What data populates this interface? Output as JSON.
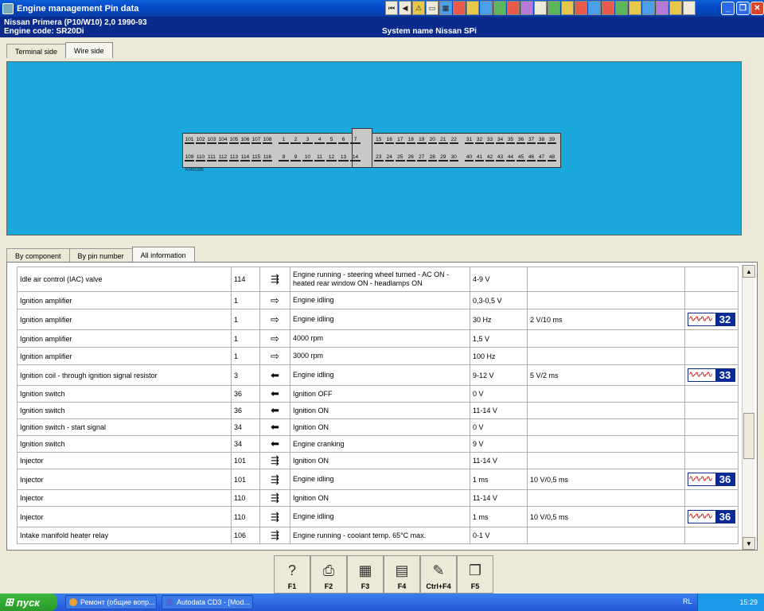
{
  "window": {
    "title": "Engine management Pin data"
  },
  "toolbar_icons": [
    "first-icon",
    "prev-icon",
    "warning-icon",
    "doc-icon",
    "chart-icon",
    "tool1-icon",
    "tool2-icon",
    "tool3-icon",
    "tool4-icon",
    "tool5-icon",
    "tool6-icon",
    "tool7-icon",
    "tool8-icon",
    "tool9-icon",
    "tool10-icon",
    "tool11-icon",
    "tool12-icon",
    "tool13-icon",
    "tool14-icon",
    "tool15-icon",
    "tool16-icon",
    "tool17-icon",
    "tool18-icon"
  ],
  "vehicle": {
    "line1": "Nissan  Primera (P10/W10) 2,0  1990-93",
    "line2": "Engine code: SR20Di",
    "system": "System name Nissan SPi"
  },
  "top_tabs": [
    "Terminal side",
    "Wire side"
  ],
  "connector": {
    "left_top": [
      "101",
      "102",
      "103",
      "104",
      "105",
      "106",
      "107",
      "108"
    ],
    "left_bottom": [
      "109",
      "110",
      "111",
      "112",
      "113",
      "114",
      "115",
      "116"
    ],
    "mid_top": [
      "1",
      "2",
      "3",
      "4",
      "5",
      "6",
      "7"
    ],
    "mid_bottom": [
      "8",
      "9",
      "10",
      "11",
      "12",
      "13",
      "14"
    ],
    "r1_top": [
      "15",
      "16",
      "17",
      "18",
      "19",
      "20",
      "21",
      "22"
    ],
    "r1_bottom": [
      "23",
      "24",
      "25",
      "26",
      "27",
      "28",
      "29",
      "30"
    ],
    "r2_top": [
      "31",
      "32",
      "33",
      "34",
      "35",
      "36",
      "37",
      "38",
      "39"
    ],
    "r2_bottom": [
      "40",
      "41",
      "42",
      "43",
      "44",
      "45",
      "46",
      "47",
      "48"
    ],
    "code": "K0431395"
  },
  "bottom_tabs": [
    "By component",
    "By pin number",
    "All information"
  ],
  "rows": [
    {
      "component": "Idle air control (IAC) valve",
      "pin": "114",
      "dir": "⇶",
      "condition": "Engine running - steering wheel turned - AC ON - heated rear window ON - headlamps ON",
      "value": "4-9 V",
      "setting": "",
      "wave": ""
    },
    {
      "component": "Ignition amplifier",
      "pin": "1",
      "dir": "⇨",
      "condition": "Engine idling",
      "value": "0,3-0,5 V",
      "setting": "",
      "wave": ""
    },
    {
      "component": "Ignition amplifier",
      "pin": "1",
      "dir": "⇨",
      "condition": "Engine idling",
      "value": "30 Hz",
      "setting": "2 V/10 ms",
      "wave": "32"
    },
    {
      "component": "Ignition amplifier",
      "pin": "1",
      "dir": "⇨",
      "condition": "4000 rpm",
      "value": "1,5 V",
      "setting": "",
      "wave": ""
    },
    {
      "component": "Ignition amplifier",
      "pin": "1",
      "dir": "⇨",
      "condition": "3000 rpm",
      "value": "100 Hz",
      "setting": "",
      "wave": ""
    },
    {
      "component": "Ignition coil - through ignition signal resistor",
      "pin": "3",
      "dir": "⬅",
      "condition": "Engine idling",
      "value": "9-12 V",
      "setting": "5 V/2 ms",
      "wave": "33"
    },
    {
      "component": "Ignition switch",
      "pin": "36",
      "dir": "⬅",
      "condition": "Ignition OFF",
      "value": "0 V",
      "setting": "",
      "wave": ""
    },
    {
      "component": "Ignition switch",
      "pin": "36",
      "dir": "⬅",
      "condition": "Ignition ON",
      "value": "11-14 V",
      "setting": "",
      "wave": ""
    },
    {
      "component": "Ignition switch - start signal",
      "pin": "34",
      "dir": "⬅",
      "condition": "Ignition ON",
      "value": "0 V",
      "setting": "",
      "wave": ""
    },
    {
      "component": "Ignition switch",
      "pin": "34",
      "dir": "⬅",
      "condition": "Engine cranking",
      "value": "9 V",
      "setting": "",
      "wave": ""
    },
    {
      "component": "Injector",
      "pin": "101",
      "dir": "⇶",
      "condition": "Ignition ON",
      "value": "11-14 V",
      "setting": "",
      "wave": ""
    },
    {
      "component": "Injector",
      "pin": "101",
      "dir": "⇶",
      "condition": "Engine idling",
      "value": "1 ms",
      "setting": "10 V/0,5 ms",
      "wave": "36"
    },
    {
      "component": "Injector",
      "pin": "110",
      "dir": "⇶",
      "condition": "Ignition ON",
      "value": "11-14 V",
      "setting": "",
      "wave": ""
    },
    {
      "component": "Injector",
      "pin": "110",
      "dir": "⇶",
      "condition": "Engine idling",
      "value": "1 ms",
      "setting": "10 V/0,5 ms",
      "wave": "36"
    },
    {
      "component": "Intake manifold heater relay",
      "pin": "106",
      "dir": "⇶",
      "condition": "Engine running - coolant temp. 65°C max.",
      "value": "0-1 V",
      "setting": "",
      "wave": ""
    }
  ],
  "fkeys": [
    {
      "label": "F1",
      "icon": "?"
    },
    {
      "label": "F2",
      "icon": "⎙"
    },
    {
      "label": "F3",
      "icon": "▦"
    },
    {
      "label": "F4",
      "icon": "▤"
    },
    {
      "label": "Ctrl+F4",
      "icon": "✎"
    },
    {
      "label": "F5",
      "icon": "❐"
    }
  ],
  "taskbar": {
    "start": "пуск",
    "tasks": [
      "Ремонт (общие вопр...",
      "Autodata CD3 - [Mod..."
    ],
    "lang": "RL",
    "clock": "15:29"
  },
  "colors": {
    "diagram_bg": "#1aa8dc",
    "header_bg": "#0a2a8c",
    "wave_num_bg": "#0a2a9a"
  }
}
